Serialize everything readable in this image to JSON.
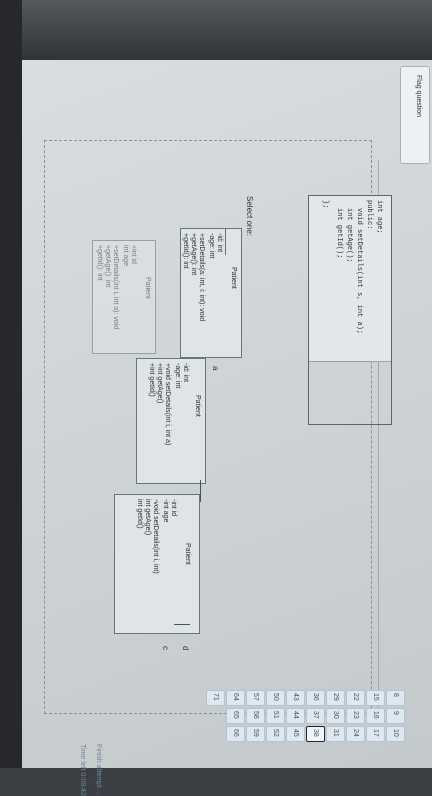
{
  "toolbar": {
    "flag_label": "Flag question"
  },
  "code": {
    "lines": [
      "int age;",
      "public:",
      "void setDetails(int s, int a);",
      "int getAge();",
      "int getId();",
      "};"
    ]
  },
  "answer_area": {
    "select_label": "Select one:",
    "option_a": "a",
    "option_b": "b",
    "option_c": "c",
    "option_d": "d"
  },
  "uml_options": [
    {
      "title": "Patient",
      "attributes": [
        "-id: int",
        "-age: int"
      ],
      "methods": [
        "+setDetails(a: int, i: int): void",
        "+getAge(): int",
        "+getId(): int"
      ]
    },
    {
      "title": "Patient",
      "attributes": [
        "+int id",
        "int age"
      ],
      "methods": [
        "+setDetails(int i, int a): void",
        "+getAge(): int",
        "+getId(): int"
      ]
    },
    {
      "title": "Patient",
      "attributes": [
        "-id: int",
        "-age: int"
      ],
      "methods": [
        "+void setDetails(int i, int a)",
        "+int getAge()",
        "+int getId()"
      ]
    },
    {
      "title": "Patient",
      "attributes": [
        "-int id",
        "-int age"
      ],
      "methods": [
        "-void setDetails(int i, int)",
        "int getAge()",
        "int getId()"
      ]
    }
  ],
  "status": {
    "finish_label": "Finish attempt ...",
    "timer": "Time left 0:09:42"
  },
  "nav": {
    "numbers": [
      "8",
      "9",
      "10",
      "15",
      "16",
      "17",
      "22",
      "23",
      "24",
      "29",
      "30",
      "31",
      "36",
      "37",
      "38",
      "43",
      "44",
      "45",
      "50",
      "51",
      "52",
      "57",
      "58",
      "59",
      "64",
      "65",
      "66",
      "71"
    ]
  },
  "colors": {
    "screen_bg": "#d3d8db",
    "nav_cell": "#dfe8ef",
    "current_border": "#1f2a33"
  }
}
